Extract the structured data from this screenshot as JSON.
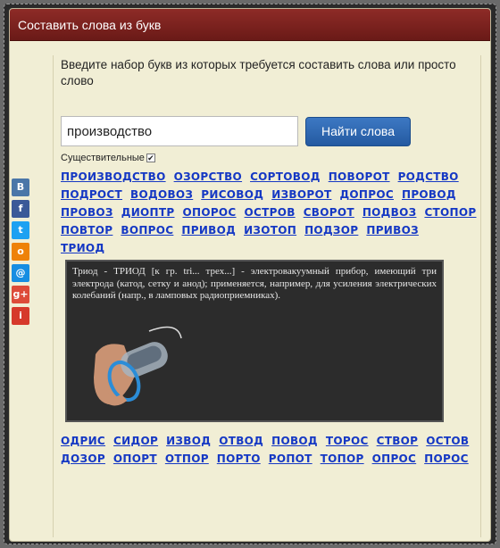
{
  "window": {
    "title": "Составить слова из букв"
  },
  "search": {
    "instruction": "Введите набор букв из которых требуется составить слова или просто слово",
    "value": "производство",
    "button_label": "Найти слова",
    "noun_label": "Существительные",
    "noun_checked": true
  },
  "social": [
    {
      "icon": "vk-icon",
      "glyph": "В",
      "color": "#4a76a8"
    },
    {
      "icon": "facebook-icon",
      "glyph": "f",
      "color": "#3b5998"
    },
    {
      "icon": "twitter-icon",
      "glyph": "t",
      "color": "#1da1f2"
    },
    {
      "icon": "odnoklassniki-icon",
      "glyph": "о",
      "color": "#ee8208"
    },
    {
      "icon": "mailru-icon",
      "glyph": "@",
      "color": "#168de2"
    },
    {
      "icon": "google-plus-icon",
      "glyph": "g+",
      "color": "#dd4b39"
    },
    {
      "icon": "liveinternet-icon",
      "glyph": "i",
      "color": "#d6392b"
    }
  ],
  "words_top": [
    [
      "ПРОИЗВОДСТВО",
      "ОЗОРСТВО",
      "СОРТОВОД",
      "ПОВОРОТ",
      "РОДСТВО"
    ],
    [
      "ПОДРОСТ",
      "ВОДОВОЗ",
      "РИСОВОД",
      "ИЗВОРОТ",
      "ДОПРОС",
      "ПРОВОД"
    ],
    [
      "ПРОВОЗ",
      "ДИОПТР",
      "ОПОРОС",
      "ОСТРОВ",
      "СВОРОТ",
      "ПОДВОЗ",
      "СТОПОР"
    ],
    [
      "ПОВТОР",
      "ВОПРОС",
      "ПРИВОД",
      "ИЗОТОП",
      "ПОДЗОР",
      "ПРИВОЗ"
    ],
    [
      "ТРИОД"
    ]
  ],
  "tooltip": {
    "text": "Триод - ТРИОД [к гр. tri... трех...] - электровакуумный прибор, имеющий три электрода (катод, сетку и анод); применяется, например, для усиления электрических колебаний (напр., в ламповых радиоприемниках)."
  },
  "words_bottom": [
    [
      "ОДРИС",
      "СИДОР",
      "ИЗВОД",
      "ОТВОД",
      "ПОВОД",
      "ТОРОС",
      "СТВОР",
      "ОСТОВ"
    ],
    [
      "ДОЗОР",
      "ОПОРТ",
      "ОТПОР",
      "ПОРТО",
      "РОПОТ",
      "ТОПОР",
      "ОПРОС",
      "ПОРОС"
    ]
  ]
}
